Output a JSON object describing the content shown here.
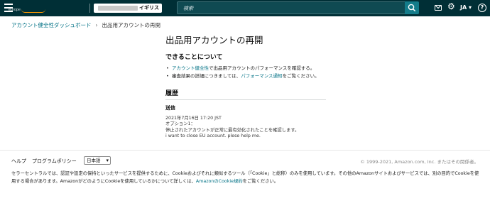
{
  "topbar": {
    "logo_main": "amazon seller central",
    "logo_sub": "europe",
    "store_region": "イギリス",
    "search_placeholder": "検索",
    "language": "JA",
    "icons": [
      "menu-icon",
      "search-icon",
      "mail-icon",
      "gear-icon",
      "help-icon"
    ]
  },
  "breadcrumb": {
    "parent": "アカウント健全性ダッシュボード",
    "separator": "›",
    "current": "出品用アカウントの再開"
  },
  "main": {
    "title": "出品用アカウントの再開",
    "section_title": "できることについて",
    "bullet1_link": "アカウント健全性",
    "bullet1_text": "で出品用アカウントのパフォーマンスを確認する。",
    "bullet2_text": "審査結果の詳細につきましては、",
    "bullet2_link": "パフォーマンス通知",
    "bullet2_after": "をご覧ください。"
  },
  "history": {
    "title": "履歴",
    "entry_label": "送信",
    "timestamp": "2021年7月16日 17:20 JST",
    "option": "オプション1：",
    "message_jp": "停止されたアカウントが正常に最有効化されたことを確認します。",
    "message_en": "i want to close EU account. plese help me."
  },
  "footer": {
    "help": "ヘルプ",
    "policy": "プログラムポリシー",
    "language_selected": "日本語",
    "copyright": "© 1999-2021, Amazon.com, Inc. またはその関係者。",
    "notice_text": "セラーセントラルでは、認証や設定の保持といったサービスを提供するために、Cookieおよびそれに類似するツール（「Cookie」と総称）のみを使用しています。その他のAmazonサイトおよびサービスでは、別の目的でCookieを使用する場合があります。AmazonがどのようにCookieを使用しているかについて詳しくは、",
    "notice_link": "AmazonのCookie規約",
    "notice_after": "をご覧ください。"
  },
  "colors": {
    "topbar": "#002f36",
    "link": "#007185",
    "search_button": "#147c8a",
    "accent": "#ff9900"
  }
}
